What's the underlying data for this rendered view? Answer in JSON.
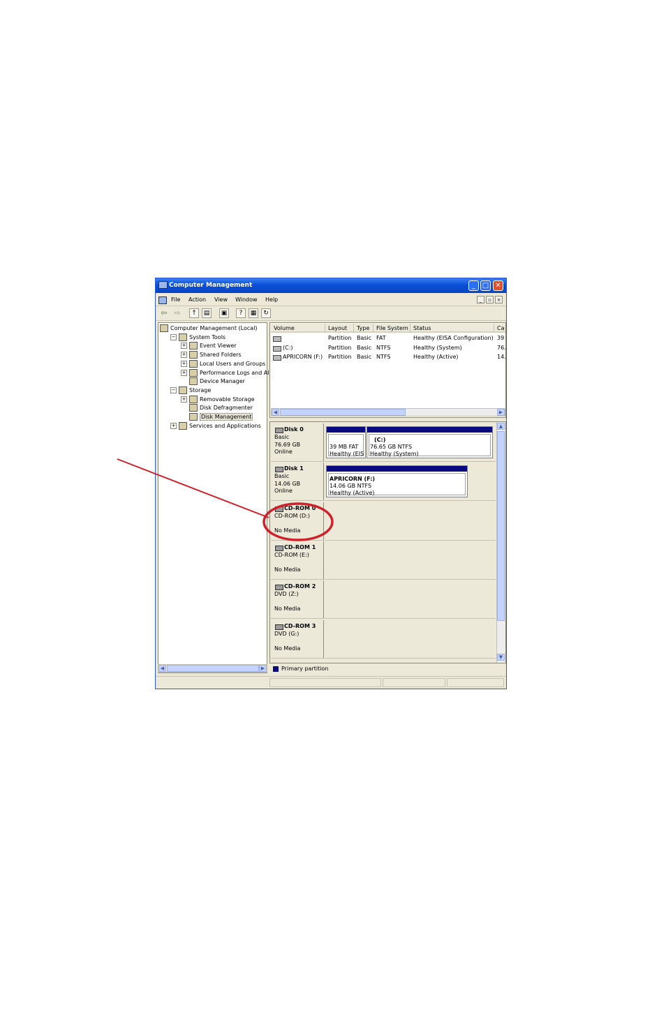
{
  "window": {
    "title": "Computer Management",
    "accent": "#0a4fd8",
    "buttons": {
      "minimize": "_",
      "maximize": "□",
      "close": "✕"
    }
  },
  "menu": [
    "File",
    "Action",
    "View",
    "Window",
    "Help"
  ],
  "tree": [
    {
      "label": "Computer Management (Local)",
      "indent": 0,
      "expander": ""
    },
    {
      "label": "System Tools",
      "indent": 1,
      "expander": "−"
    },
    {
      "label": "Event Viewer",
      "indent": 2,
      "expander": "+"
    },
    {
      "label": "Shared Folders",
      "indent": 2,
      "expander": "+"
    },
    {
      "label": "Local Users and Groups",
      "indent": 2,
      "expander": "+"
    },
    {
      "label": "Performance Logs and Alerts",
      "indent": 2,
      "expander": "+"
    },
    {
      "label": "Device Manager",
      "indent": 2,
      "expander": ""
    },
    {
      "label": "Storage",
      "indent": 1,
      "expander": "−"
    },
    {
      "label": "Removable Storage",
      "indent": 2,
      "expander": "+"
    },
    {
      "label": "Disk Defragmenter",
      "indent": 2,
      "expander": ""
    },
    {
      "label": "Disk Management",
      "indent": 2,
      "expander": "",
      "selected": true
    },
    {
      "label": "Services and Applications",
      "indent": 1,
      "expander": "+"
    }
  ],
  "volumes": {
    "headers": [
      "Volume",
      "Layout",
      "Type",
      "File System",
      "Status",
      "Ca"
    ],
    "rows": [
      [
        "",
        "Partition",
        "Basic",
        "FAT",
        "Healthy (EISA Configuration)",
        "39"
      ],
      [
        "(C:)",
        "Partition",
        "Basic",
        "NTFS",
        "Healthy (System)",
        "76."
      ],
      [
        "APRICORN (F:)",
        "Partition",
        "Basic",
        "NTFS",
        "Healthy (Active)",
        "14."
      ]
    ]
  },
  "disks": [
    {
      "name": "Disk 0",
      "lines": [
        "Basic",
        "76.69 GB",
        "Online"
      ],
      "partitions": [
        {
          "title": "",
          "size": "39 MB FAT",
          "status": "Healthy (EIS"
        },
        {
          "title": "(C:)",
          "size": "76.65 GB NTFS",
          "status": "Healthy (System)"
        }
      ]
    },
    {
      "name": "Disk 1",
      "lines": [
        "Basic",
        "14.06 GB",
        "Online"
      ],
      "partitions": [
        {
          "title": "APRICORN  (F:)",
          "size": "14.06 GB NTFS",
          "status": "Healthy (Active)"
        }
      ]
    },
    {
      "name": "CD-ROM 0",
      "lines": [
        "CD-ROM (D:)",
        "",
        "No Media"
      ],
      "partitions": []
    },
    {
      "name": "CD-ROM 1",
      "lines": [
        "CD-ROM (E:)",
        "",
        "No Media"
      ],
      "partitions": []
    },
    {
      "name": "CD-ROM 2",
      "lines": [
        "DVD (Z:)",
        "",
        "No Media"
      ],
      "partitions": []
    },
    {
      "name": "CD-ROM 3",
      "lines": [
        "DVD (G:)",
        "",
        "No Media"
      ],
      "partitions": []
    }
  ],
  "legend": {
    "label": "Primary partition",
    "color": "#0a0a80"
  },
  "annotation": {
    "color": "#d0202a"
  }
}
